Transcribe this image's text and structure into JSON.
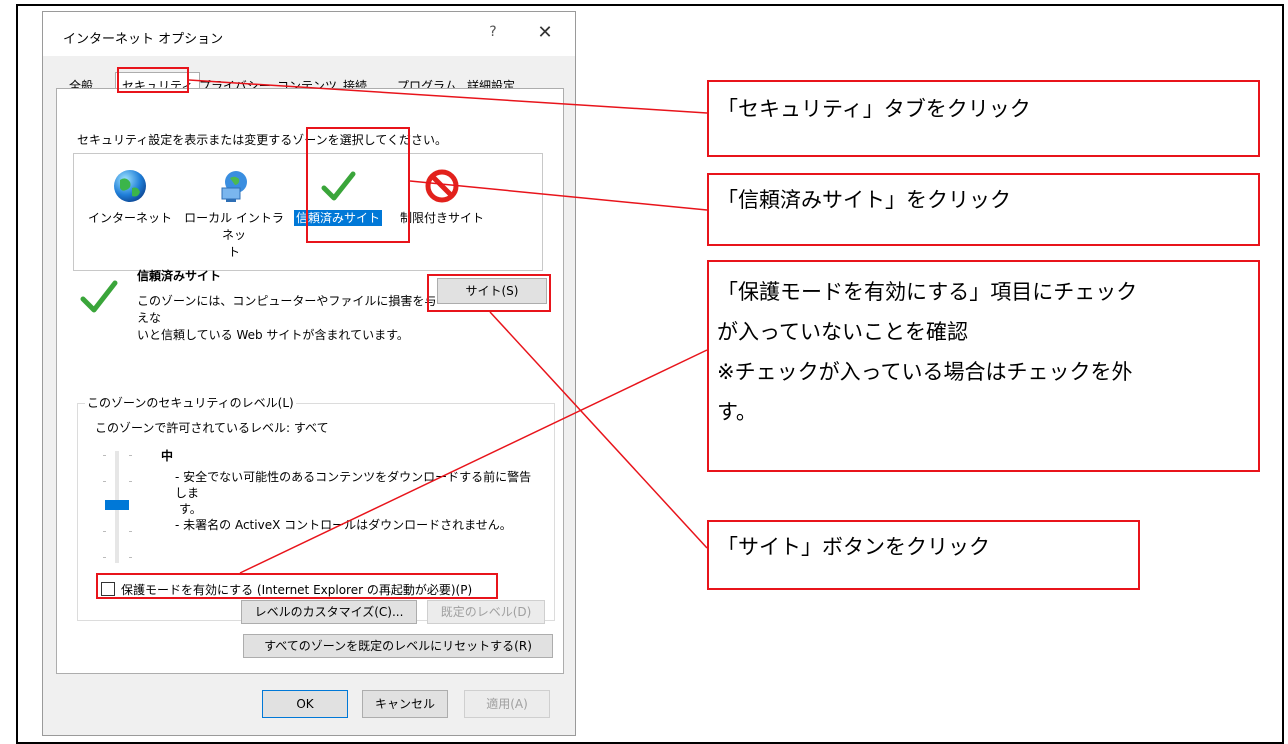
{
  "dialog": {
    "title": "インターネット オプション",
    "help": "?",
    "close": "✕",
    "tabs": [
      "全般",
      "セキュリティ",
      "プライバシー",
      "コンテンツ",
      "接続",
      "プログラム",
      "詳細設定"
    ],
    "active_tab": "セキュリティ",
    "zone_prompt": "セキュリティ設定を表示または変更するゾーンを選択してください。",
    "zones": [
      {
        "label": "インターネット",
        "icon": "globe-icon"
      },
      {
        "label": "ローカル イントラネッ\nト",
        "icon": "intranet-icon"
      },
      {
        "label": "信頼済みサイト",
        "icon": "checkmark-icon",
        "selected": true
      },
      {
        "label": "制限付きサイト",
        "icon": "restricted-icon"
      }
    ],
    "zone_info": {
      "title": "信頼済みサイト",
      "line1": "このゾーンには、コンピューターやファイルに損害を与えな",
      "line2": "いと信頼している Web サイトが含まれています。"
    },
    "sites_button": "サイト(S)",
    "security_level": {
      "group_title": "このゾーンのセキュリティのレベル(L)",
      "allowed": "このゾーンで許可されているレベル: すべて",
      "level_name": "中",
      "desc1": "- 安全でない可能性のあるコンテンツをダウンロードする前に警告しま",
      "desc2": "す。",
      "desc3": "- 未署名の ActiveX コントロールはダウンロードされません。"
    },
    "protected_mode": {
      "label": "保護モードを有効にする (Internet Explorer の再起動が必要)(P)",
      "checked": false
    },
    "custom_level_button": "レベルのカスタマイズ(C)...",
    "default_level_button": "既定のレベル(D)",
    "reset_all_button": "すべてのゾーンを既定のレベルにリセットする(R)",
    "ok_button": "OK",
    "cancel_button": "キャンセル",
    "apply_button": "適用(A)"
  },
  "callouts": {
    "security_tab": "「セキュリティ」タブをクリック",
    "trusted_sites": "「信頼済みサイト」をクリック",
    "protected_mode_line1": "「保護モードを有効にする」項目にチェック",
    "protected_mode_line2": "が入っていないことを確認",
    "protected_mode_line3": "※チェックが入っている場合はチェックを外",
    "protected_mode_line4": "す。",
    "sites_button": "「サイト」ボタンをクリック"
  },
  "colors": {
    "annotation_red": "#e8141b",
    "selection_blue": "#0078d7",
    "check_green": "#3aa53a"
  }
}
